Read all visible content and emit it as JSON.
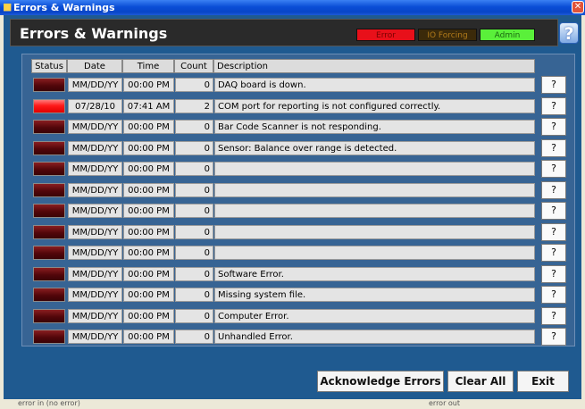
{
  "window": {
    "title": "Errors & Warnings"
  },
  "header": {
    "title": "Errors & Warnings",
    "indicators": {
      "error": "Error",
      "io_forcing": "IO Forcing",
      "admin": "Admin"
    },
    "help": "?"
  },
  "table": {
    "columns": [
      "Status",
      "Date",
      "Time",
      "Count",
      "Description"
    ],
    "rows": [
      {
        "status": "off",
        "date": "MM/DD/YY",
        "time": "00:00 PM",
        "count": "0",
        "description": "DAQ board is down."
      },
      {
        "status": "on",
        "date": "07/28/10",
        "time": "07:41 AM",
        "count": "2",
        "description": "COM port for reporting is not configured correctly."
      },
      {
        "status": "off",
        "date": "MM/DD/YY",
        "time": "00:00 PM",
        "count": "0",
        "description": "Bar Code Scanner is not responding."
      },
      {
        "status": "off",
        "date": "MM/DD/YY",
        "time": "00:00 PM",
        "count": "0",
        "description": "Sensor:  Balance over range is detected."
      },
      {
        "status": "off",
        "date": "MM/DD/YY",
        "time": "00:00 PM",
        "count": "0",
        "description": ""
      },
      {
        "status": "off",
        "date": "MM/DD/YY",
        "time": "00:00 PM",
        "count": "0",
        "description": ""
      },
      {
        "status": "off",
        "date": "MM/DD/YY",
        "time": "00:00 PM",
        "count": "0",
        "description": ""
      },
      {
        "status": "off",
        "date": "MM/DD/YY",
        "time": "00:00 PM",
        "count": "0",
        "description": ""
      },
      {
        "status": "off",
        "date": "MM/DD/YY",
        "time": "00:00 PM",
        "count": "0",
        "description": ""
      },
      {
        "status": "off",
        "date": "MM/DD/YY",
        "time": "00:00 PM",
        "count": "0",
        "description": "Software Error."
      },
      {
        "status": "off",
        "date": "MM/DD/YY",
        "time": "00:00 PM",
        "count": "0",
        "description": "Missing system file."
      },
      {
        "status": "off",
        "date": "MM/DD/YY",
        "time": "00:00 PM",
        "count": "0",
        "description": "Computer Error."
      },
      {
        "status": "off",
        "date": "MM/DD/YY",
        "time": "00:00 PM",
        "count": "0",
        "description": "Unhandled Error."
      }
    ],
    "info_button": "?"
  },
  "buttons": {
    "acknowledge": "Acknowledge Errors",
    "clear_all": "Clear All",
    "exit": "Exit"
  },
  "statusbar": {
    "left": "error in (no error)",
    "right": "error out"
  },
  "colors": {
    "led_on": "#FF1A1A",
    "led_off": "#52060A",
    "panel": "#1F5A90"
  }
}
